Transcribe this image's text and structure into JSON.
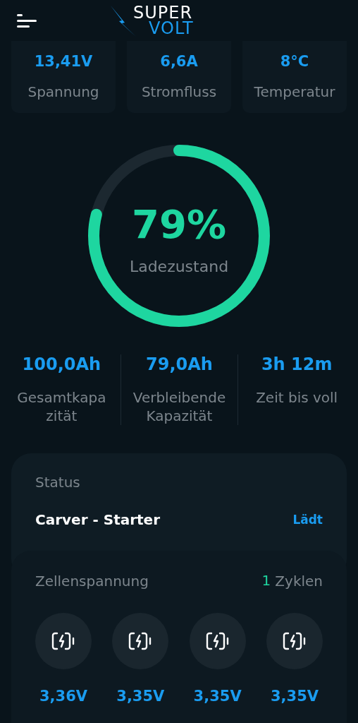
{
  "header": {
    "logo": {
      "top": "SUPER",
      "bottom": "VOLT"
    }
  },
  "metrics": [
    {
      "value": "13,41V",
      "label": "Spannung"
    },
    {
      "value": "6,6A",
      "label": "Stromfluss"
    },
    {
      "value": "8°C",
      "label": "Temperatur"
    }
  ],
  "gauge": {
    "level": 0.79,
    "value": "79%",
    "label": "Ladezustand"
  },
  "capacity": [
    {
      "value": "100,0Ah",
      "label": "Gesamtkapa zität"
    },
    {
      "value": "79,0Ah",
      "label": "Verbleibende Kapazität"
    },
    {
      "value": "3h 12m",
      "label": "Zeit bis voll"
    }
  ],
  "status": {
    "title": "Status",
    "name": "Carver - Starter",
    "state": "Lädt"
  },
  "cells": {
    "title": "Zellenspannung",
    "cycles": {
      "count": "1",
      "label": "Zyklen"
    },
    "items": [
      {
        "voltage": "3,36V"
      },
      {
        "voltage": "3,35V"
      },
      {
        "voltage": "3,35V"
      },
      {
        "voltage": "3,35V"
      }
    ]
  }
}
